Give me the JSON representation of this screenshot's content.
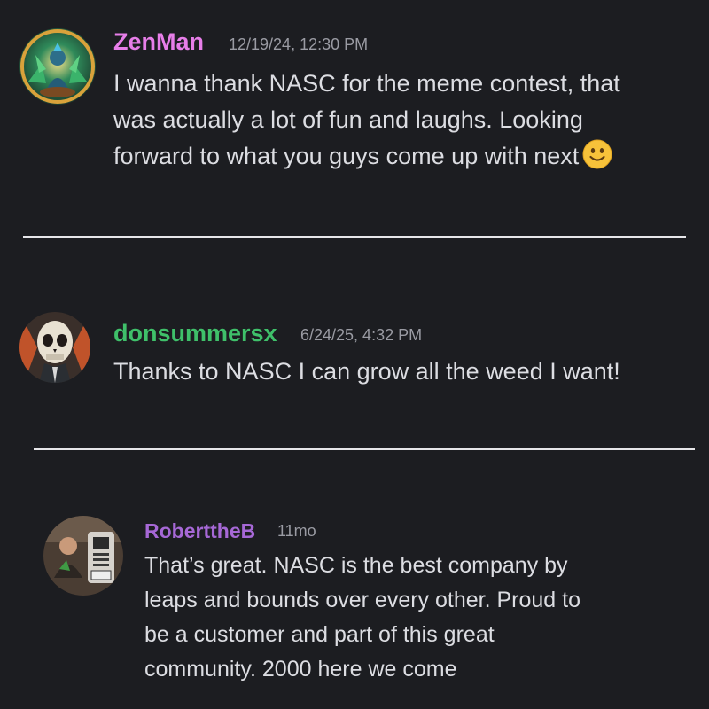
{
  "messages": [
    {
      "username": "ZenMan",
      "username_color": "#e77ee9",
      "timestamp": "12/19/24, 12:30 PM",
      "lines": [
        "I wanna thank NASC for the meme contest, that",
        "was actually a lot of fun and laughs. Looking",
        "forward to what you guys come up with next"
      ],
      "emoji": "slightly-smiling-face"
    },
    {
      "username": "donsummersx",
      "username_color": "#3fc06a",
      "timestamp": "6/24/25, 4:32 PM",
      "lines": [
        "Thanks to NASC I can grow all the weed I want!"
      ]
    },
    {
      "username": "RoberttheB",
      "username_color": "#a668d6",
      "timestamp": "11mo",
      "lines": [
        "That’s great. NASC is the best company by",
        "leaps and bounds over every other. Proud to",
        "be a customer and part of this great",
        "community. 2000 here we come"
      ]
    }
  ],
  "colors": {
    "background": "#1c1d21",
    "body_text": "#dcdde2",
    "timestamp": "#9a9ba3",
    "divider": "#e6e6e9"
  }
}
